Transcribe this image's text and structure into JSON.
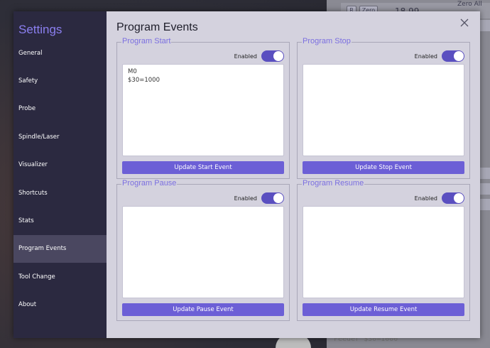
{
  "background": {
    "chips": [
      "R",
      "Zero"
    ],
    "readout": "18.99",
    "zero_all": "Zero All",
    "bottom_text": "Feeder $30=1000"
  },
  "sidebar": {
    "title": "Settings",
    "items": [
      {
        "label": "General",
        "active": false
      },
      {
        "label": "Safety",
        "active": false
      },
      {
        "label": "Probe",
        "active": false
      },
      {
        "label": "Spindle/Laser",
        "active": false
      },
      {
        "label": "Visualizer",
        "active": false
      },
      {
        "label": "Shortcuts",
        "active": false
      },
      {
        "label": "Stats",
        "active": false
      },
      {
        "label": "Program Events",
        "active": true
      },
      {
        "label": "Tool Change",
        "active": false
      },
      {
        "label": "About",
        "active": false
      }
    ]
  },
  "main": {
    "title": "Program Events",
    "close_icon": "close-icon",
    "events": [
      {
        "key": "start",
        "legend": "Program Start",
        "toggle_label": "Enabled",
        "enabled": true,
        "code": "M0\n$30=1000",
        "button_label": "Update Start Event"
      },
      {
        "key": "stop",
        "legend": "Program Stop",
        "toggle_label": "Enabled",
        "enabled": true,
        "code": "",
        "button_label": "Update Stop Event"
      },
      {
        "key": "pause",
        "legend": "Program Pause",
        "toggle_label": "Enabled",
        "enabled": true,
        "code": "",
        "button_label": "Update Pause Event"
      },
      {
        "key": "resume",
        "legend": "Program Resume",
        "toggle_label": "Enabled",
        "enabled": true,
        "code": "",
        "button_label": "Update Resume Event"
      }
    ]
  },
  "colors": {
    "sidebar_bg": "#2b2940",
    "accent": "#6c5fd6",
    "legend": "#7b6fe0",
    "panel_bg": "#d4d2de"
  }
}
